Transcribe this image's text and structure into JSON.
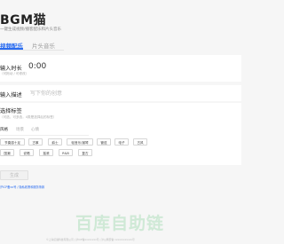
{
  "app": {
    "brand": "BGM猫",
    "slogan": "一键生成视频/播客配乐和片头音乐"
  },
  "tabs": [
    {
      "label": "视频配乐",
      "active": true
    },
    {
      "label": "片头音乐",
      "active": false
    }
  ],
  "duration": {
    "label": "输入时长",
    "sublabel": "（可拖动 / 可修改）",
    "value": "0:00"
  },
  "description": {
    "label": "输入描述",
    "placeholder": "写下你的创意"
  },
  "tags": {
    "label": "选择标签",
    "sublabel": "（可选，可多选，4类是选择后的标签）",
    "categories": [
      {
        "label": "风格",
        "active": true
      },
      {
        "label": "场景",
        "active": false
      },
      {
        "label": "心情",
        "active": false
      }
    ],
    "chips_row1": [
      "节奏感十足",
      "古筝",
      "爵士",
      "轻音乐/钢琴",
      "管弦",
      "电子",
      "古风"
    ],
    "chips_row2": [
      "国潮",
      "说唱",
      "摇滚",
      "R&B",
      "复古"
    ]
  },
  "generate": {
    "label": "生成"
  },
  "beian": "沪ICP备xx号 / 隐私政策和服务条款",
  "watermark": "百库自助链",
  "footer": "©上海幻猫科技有限公司 | 沪ICP备xxxxxxxx号 | 沪公网安备 xxxxxxxxxxxx号"
}
